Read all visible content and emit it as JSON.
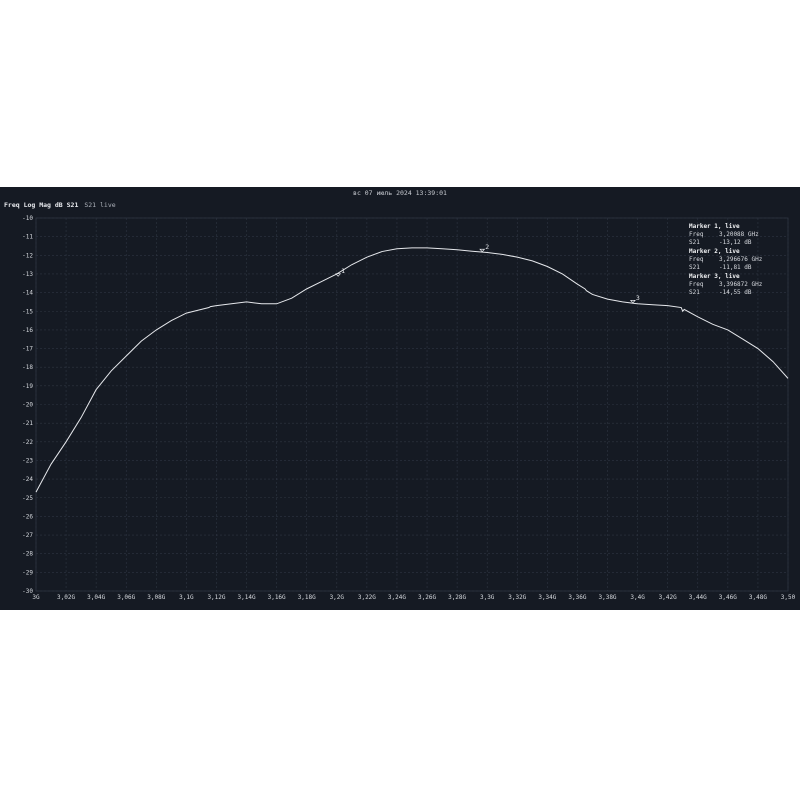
{
  "header": {
    "timestamp": "вс 07 июль 2024 13:39:01",
    "trace_title": "Freq Log Mag dB S21",
    "trace_status": "S21 live"
  },
  "markers_panel": [
    {
      "title": "Marker 1, live",
      "freq_label": "Freq",
      "freq_value": "3,20088 GHz",
      "param_label": "S21",
      "param_value": "-13,12 dB"
    },
    {
      "title": "Marker 2, live",
      "freq_label": "Freq",
      "freq_value": "3,296676 GHz",
      "param_label": "S21",
      "param_value": "-11,81 dB"
    },
    {
      "title": "Marker 3, live",
      "freq_label": "Freq",
      "freq_value": "3,396872 GHz",
      "param_label": "S21",
      "param_value": "-14,55 dB"
    }
  ],
  "colors": {
    "background": "#151a23",
    "grid": "#2e3542",
    "trace": "#e6e8ec",
    "text": "#d8dbe0"
  },
  "chart_data": {
    "type": "line",
    "xlim": [
      3.0,
      3.5
    ],
    "ylim": [
      -30,
      -10
    ],
    "x_ticks": [
      3.0,
      3.02,
      3.04,
      3.06,
      3.08,
      3.1,
      3.12,
      3.14,
      3.16,
      3.18,
      3.2,
      3.22,
      3.24,
      3.26,
      3.28,
      3.3,
      3.32,
      3.34,
      3.36,
      3.38,
      3.4,
      3.42,
      3.44,
      3.46,
      3.48,
      3.5
    ],
    "x_tick_labels": [
      "3G",
      "3,02G",
      "3,04G",
      "3,06G",
      "3,08G",
      "3,1G",
      "3,12G",
      "3,14G",
      "3,16G",
      "3,18G",
      "3,2G",
      "3,22G",
      "3,24G",
      "3,26G",
      "3,28G",
      "3,3G",
      "3,32G",
      "3,34G",
      "3,36G",
      "3,38G",
      "3,4G",
      "3,42G",
      "3,44G",
      "3,46G",
      "3,48G",
      "3,50"
    ],
    "y_ticks": [
      -10,
      -11,
      -12,
      -13,
      -14,
      -15,
      -16,
      -17,
      -18,
      -19,
      -20,
      -21,
      -22,
      -23,
      -24,
      -25,
      -26,
      -27,
      -28,
      -29,
      -30
    ],
    "y_tick_labels": [
      "-10",
      "-11",
      "-12",
      "-13",
      "-14",
      "-15",
      "-16",
      "-17",
      "-18",
      "-19",
      "-20",
      "-21",
      "-22",
      "-23",
      "-24",
      "-25",
      "-26",
      "-27",
      "-28",
      "-29",
      "-30"
    ],
    "grid": true,
    "series": [
      {
        "name": "S21",
        "x": [
          3.0,
          3.01,
          3.02,
          3.03,
          3.04,
          3.05,
          3.06,
          3.07,
          3.08,
          3.09,
          3.1,
          3.11,
          3.115,
          3.116,
          3.12,
          3.13,
          3.14,
          3.15,
          3.16,
          3.17,
          3.18,
          3.19,
          3.2,
          3.21,
          3.22,
          3.23,
          3.24,
          3.25,
          3.26,
          3.27,
          3.28,
          3.29,
          3.3,
          3.31,
          3.32,
          3.33,
          3.34,
          3.35,
          3.36,
          3.365,
          3.366,
          3.37,
          3.38,
          3.39,
          3.4,
          3.41,
          3.42,
          3.429,
          3.43,
          3.431,
          3.44,
          3.45,
          3.46,
          3.47,
          3.48,
          3.49,
          3.5
        ],
        "y": [
          -24.7,
          -23.2,
          -22.0,
          -20.7,
          -19.2,
          -18.2,
          -17.4,
          -16.6,
          -16.0,
          -15.5,
          -15.1,
          -14.9,
          -14.8,
          -14.75,
          -14.7,
          -14.6,
          -14.5,
          -14.6,
          -14.6,
          -14.3,
          -13.8,
          -13.4,
          -13.0,
          -12.5,
          -12.1,
          -11.8,
          -11.65,
          -11.6,
          -11.6,
          -11.65,
          -11.7,
          -11.78,
          -11.85,
          -11.95,
          -12.1,
          -12.3,
          -12.6,
          -13.0,
          -13.55,
          -13.8,
          -13.9,
          -14.1,
          -14.35,
          -14.5,
          -14.6,
          -14.65,
          -14.7,
          -14.8,
          -15.0,
          -14.9,
          -15.3,
          -15.7,
          -16.0,
          -16.5,
          -17.0,
          -17.7,
          -18.6
        ]
      }
    ],
    "markers": [
      {
        "label": "1",
        "x": 3.20088,
        "y": -13.12
      },
      {
        "label": "2",
        "x": 3.296676,
        "y": -11.81
      },
      {
        "label": "3",
        "x": 3.396872,
        "y": -14.55
      }
    ]
  }
}
